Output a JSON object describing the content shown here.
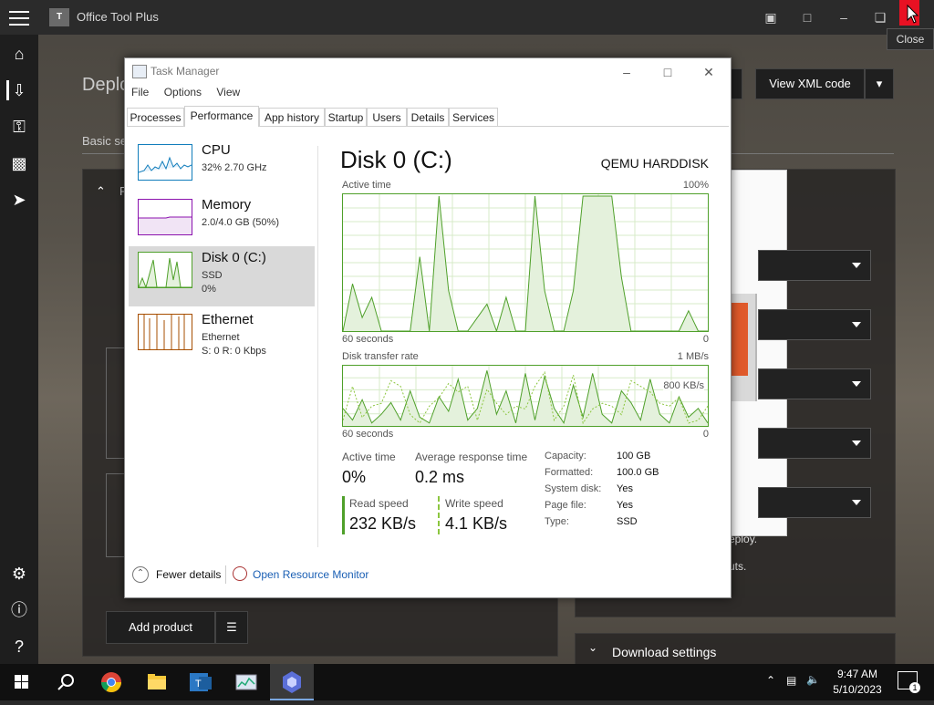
{
  "otp": {
    "title": "Office Tool Plus",
    "logo_text": "T",
    "heading_partial": "Deplo",
    "tab_partial": "Basic se",
    "section_partial": "P",
    "view_xml_label": "View XML code",
    "add_product_label": "Add product",
    "download_settings_label": "Download settings",
    "deploy_partial": "eploy.",
    "uts_partial": "uts.",
    "close_tooltip": "Close"
  },
  "tm": {
    "title": "Task Manager",
    "menu": [
      "File",
      "Options",
      "View"
    ],
    "tabs": [
      "Processes",
      "Performance",
      "App history",
      "Startup",
      "Users",
      "Details",
      "Services"
    ],
    "sidebar": [
      {
        "name": "CPU",
        "line1": "32%  2.70 GHz",
        "line2": ""
      },
      {
        "name": "Memory",
        "line1": "2.0/4.0 GB (50%)",
        "line2": ""
      },
      {
        "name": "Disk 0 (C:)",
        "line1": "SSD",
        "line2": "0%"
      },
      {
        "name": "Ethernet",
        "line1": "Ethernet",
        "line2": "S: 0  R: 0 Kbps"
      }
    ],
    "disk": {
      "title": "Disk 0 (C:)",
      "model": "QEMU HARDDISK",
      "active_time_label": "Active time",
      "active_time_max": "100%",
      "seconds_label": "60 seconds",
      "zero": "0",
      "transfer_label": "Disk transfer rate",
      "transfer_max": "1 MB/s",
      "transfer_mid": "800 KB/s",
      "stats": {
        "active_time_label": "Active time",
        "active_time_value": "0%",
        "avg_resp_label": "Average response time",
        "avg_resp_value": "0.2 ms",
        "read_label": "Read speed",
        "read_value": "232 KB/s",
        "write_label": "Write speed",
        "write_value": "4.1 KB/s"
      },
      "props": [
        {
          "k": "Capacity:",
          "v": "100 GB"
        },
        {
          "k": "Formatted:",
          "v": "100.0 GB"
        },
        {
          "k": "System disk:",
          "v": "Yes"
        },
        {
          "k": "Page file:",
          "v": "Yes"
        },
        {
          "k": "Type:",
          "v": "SSD"
        }
      ]
    },
    "fewer_details": "Fewer details",
    "open_resource_monitor": "Open Resource Monitor",
    "active_time_series": [
      0,
      35,
      10,
      25,
      0,
      0,
      0,
      0,
      55,
      0,
      100,
      30,
      0,
      0,
      10,
      20,
      0,
      25,
      0,
      0,
      100,
      30,
      0,
      0,
      30,
      100,
      100,
      100,
      100,
      40,
      0,
      0,
      0,
      0,
      0,
      0,
      15,
      0,
      0
    ],
    "transfer_series": [
      30,
      10,
      45,
      5,
      20,
      40,
      10,
      60,
      15,
      5,
      50,
      25,
      80,
      10,
      30,
      95,
      20,
      60,
      5,
      90,
      10,
      85,
      30,
      5,
      70,
      15,
      90,
      20,
      5,
      60,
      40,
      10,
      80,
      20,
      5,
      50,
      15,
      30,
      5
    ]
  },
  "taskbar": {
    "time": "9:47 AM",
    "date": "5/10/2023",
    "notification_count": "1"
  },
  "colors": {
    "disk_green": "#4fa02a",
    "cpu_blue": "#117dbb",
    "mem_purple": "#8b12ae",
    "eth_orange": "#a74f01",
    "close_red": "#e81123"
  }
}
